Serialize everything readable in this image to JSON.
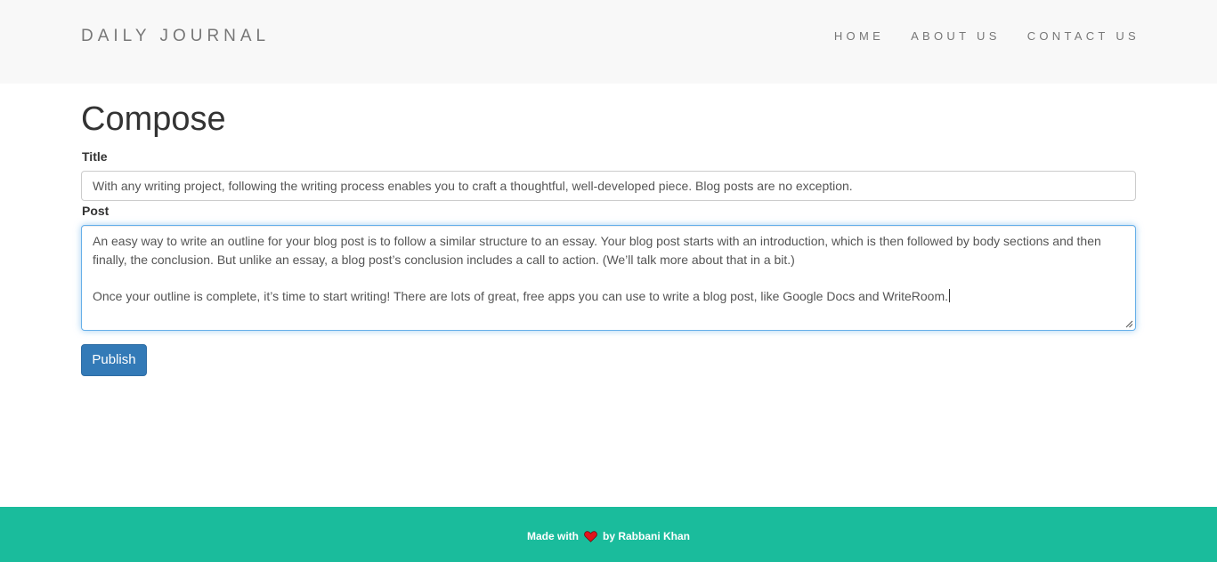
{
  "navbar": {
    "brand": "DAILY JOURNAL",
    "links": [
      {
        "label": "HOME"
      },
      {
        "label": "ABOUT US"
      },
      {
        "label": "CONTACT US"
      }
    ]
  },
  "compose": {
    "heading": "Compose",
    "title_label": "Title",
    "title_value": "With any writing project, following the writing process enables you to craft a thoughtful, well-developed piece. Blog posts are no exception.",
    "post_label": "Post",
    "post_paragraphs": [
      "An easy way to write an outline for your blog post is to follow a similar structure to an essay. Your blog post starts with an introduction, which is then followed by body sections and then finally, the conclusion. But unlike an essay, a blog post’s conclusion includes a call to action. (We’ll talk more about that in a bit.)",
      "Once your outline is complete, it’s time to start writing! There are lots of great, free apps you can use to write a blog post, like Google Docs and WriteRoom."
    ],
    "publish_label": "Publish"
  },
  "footer": {
    "made_with": "Made with",
    "heart_icon": "heart-icon",
    "by_author": "by Rabbani Khan"
  },
  "colors": {
    "navbar_bg": "#f8f8f8",
    "primary_button": "#337ab7",
    "footer_bg": "#1abc9c",
    "heart": "#e0131c",
    "focus_border": "#66afe9"
  }
}
